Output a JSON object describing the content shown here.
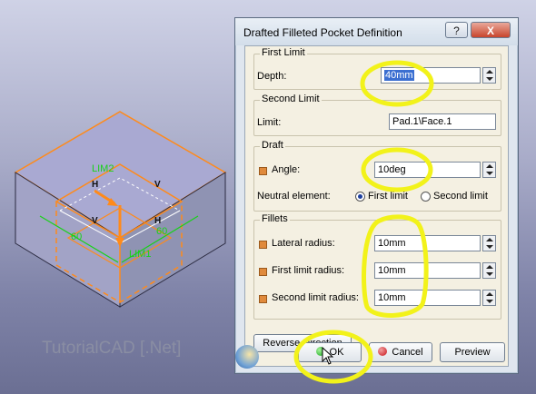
{
  "viewport": {
    "watermark": "TutorialCAD [.Net]",
    "labels": {
      "lim2": "LIM2",
      "lim1": "LIM1",
      "h_top": "H",
      "v_top": "V",
      "h_mid": "H",
      "v_mid": "V",
      "dim_left": "60",
      "dim_right": "60"
    }
  },
  "dialog": {
    "title": "Drafted Filleted Pocket Definition",
    "help_label": "?",
    "close_label": "X",
    "first_limit": {
      "group_title": "First Limit",
      "depth_label": "Depth:",
      "depth_value": "40mm"
    },
    "second_limit": {
      "group_title": "Second Limit",
      "limit_label": "Limit:",
      "limit_value": "Pad.1\\Face.1"
    },
    "draft": {
      "group_title": "Draft",
      "angle_label": "Angle:",
      "angle_value": "10deg",
      "neutral_label": "Neutral element:",
      "options": [
        "First limit",
        "Second limit"
      ],
      "selected": "First limit"
    },
    "fillets": {
      "group_title": "Fillets",
      "lateral_label": "Lateral radius:",
      "lateral_value": "10mm",
      "first_label": "First limit radius:",
      "first_value": "10mm",
      "second_label": "Second limit radius:",
      "second_value": "10mm"
    },
    "buttons": {
      "reverse": "Reverse Direction",
      "ok": "OK",
      "cancel": "Cancel",
      "preview": "Preview"
    }
  },
  "colors": {
    "highlight": "#f2f21a",
    "part_edge": "#ff7f00",
    "axis_green": "#19d119",
    "top_face": "#a9a9d1",
    "side_face": "#8f93b4"
  }
}
